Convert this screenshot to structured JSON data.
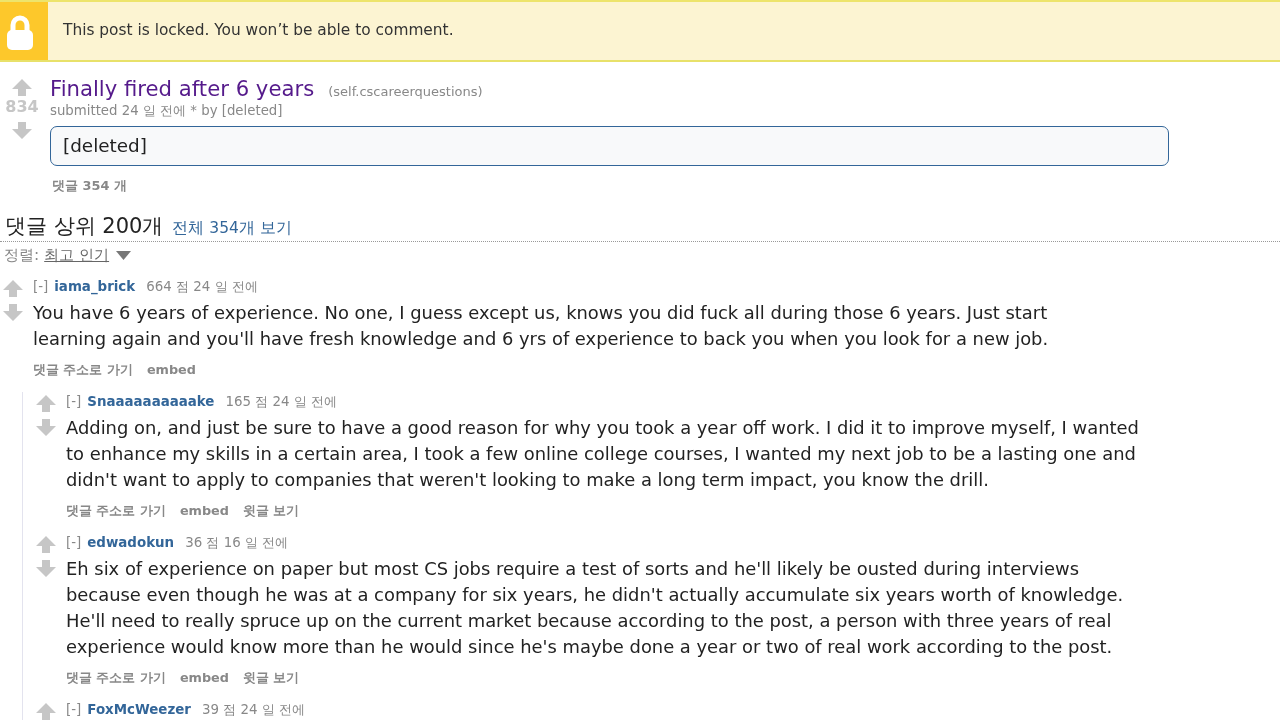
{
  "locked_banner": {
    "text": "This post is locked. You won’t be able to comment."
  },
  "post": {
    "score": "834",
    "title": "Finally fired after 6 years",
    "domain": "(self.cscareerquestions)",
    "tagline": "submitted 24 일 전에 * by [deleted]",
    "body": "[deleted]",
    "comments_link": "댓글 354 개"
  },
  "comment_area": {
    "title": "댓글 상위 200개",
    "view_all": "전체 354개 보기",
    "sort_label": "정렬:",
    "sort_value": "최고 인기"
  },
  "comments": [
    {
      "collapse": "[-]",
      "author": "iama_brick",
      "score": "664 점",
      "time": "24 일 전에",
      "body": "You have 6 years of experience. No one, I guess except us, knows you did fuck all during those 6 years. Just start learning again and you'll have fresh knowledge and 6 yrs of experience to back you when you look for a new job.",
      "buttons": [
        "댓글 주소로 가기",
        "embed"
      ],
      "children": [
        {
          "collapse": "[-]",
          "author": "Snaaaaaaaaaake",
          "score": "165 점",
          "time": "24 일 전에",
          "body": "Adding on, and just be sure to have a good reason for why you took a year off work. I did it to improve myself, I wanted to enhance my skills in a certain area, I took a few online college courses, I wanted my next job to be a lasting one and didn't want to apply to companies that weren't looking to make a long term impact, you know the drill.",
          "buttons": [
            "댓글 주소로 가기",
            "embed",
            "윗글 보기"
          ]
        },
        {
          "collapse": "[-]",
          "author": "edwadokun",
          "score": "36 점",
          "time": "16 일 전에",
          "body": "Eh six of experience on paper but most CS jobs require a test of sorts and he'll likely be ousted during interviews because even though he was at a company for six years, he didn't actually accumulate six years worth of knowledge. He'll need to really spruce up on the current market because according to the post, a person with three years of real experience would know more than he would since he's maybe done a year or two of real work according to the post.",
          "buttons": [
            "댓글 주소로 가기",
            "embed",
            "윗글 보기"
          ]
        },
        {
          "collapse": "[-]",
          "author": "FoxMcWeezer",
          "score": "39 점",
          "time": "24 일 전에"
        }
      ]
    }
  ]
}
